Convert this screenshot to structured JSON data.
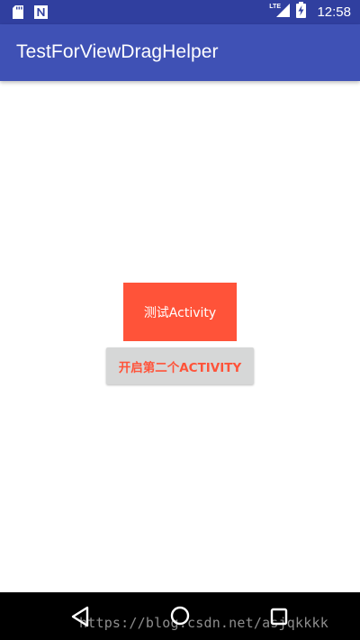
{
  "status_bar": {
    "time": "12:58",
    "network_label": "LTE",
    "left_icons": [
      "sd-card-icon",
      "n-notification-icon"
    ],
    "right_icons": [
      "lte-signal-icon",
      "battery-charging-icon"
    ]
  },
  "app_bar": {
    "title": "TestForViewDragHelper"
  },
  "main": {
    "test_view_label": "测试Activity",
    "open_second_button_label": "开启第二个ACTIVITY"
  },
  "nav_bar": {
    "icons": [
      "back-icon",
      "home-icon",
      "recents-icon"
    ]
  },
  "watermark": "https://blog.csdn.net/asjqkkkk",
  "colors": {
    "status_bar": "#303f9f",
    "app_bar": "#3f51b5",
    "accent": "#ff5339",
    "button_bg": "#d6d7d7",
    "nav_bar": "#000000"
  }
}
